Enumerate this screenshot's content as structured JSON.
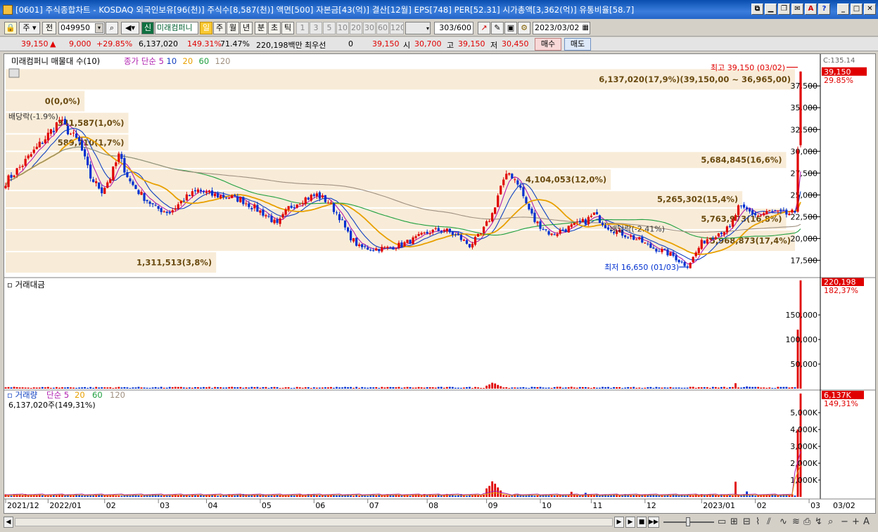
{
  "titlebar": {
    "text": "[0601] 주식종합차트 - KOSDAQ 외국인보유[96(천)] 주식수[8,587(천)] 액면[500] 자본금[43(억)] 결산[12월] EPS[748] PER[52.31] 시가총액[3,362(억)] 유통비율[58.7]",
    "buttons": [
      "⧉",
      "▁",
      "❐",
      "✉",
      "A",
      "?",
      "_",
      "□",
      "✕"
    ]
  },
  "toolbar": {
    "market": "주",
    "prev_label": "전",
    "code": "049950",
    "stock_name": "미래컴퍼니",
    "period_selected": "일",
    "periods": [
      "주",
      "월",
      "년",
      "분",
      "초",
      "틱"
    ],
    "intervals": [
      "1",
      "3",
      "5",
      "10",
      "20",
      "30",
      "60",
      "120"
    ],
    "count": "303/600",
    "date": "2023/03/02"
  },
  "infobar": {
    "price": "39,150",
    "change": "9,000",
    "change_pct": "+29.85%",
    "volume": "6,137,020",
    "volume_ratio": "149.31%",
    "turnover": "71.47%",
    "amount": "220,198백만",
    "pref_label": "최우선",
    "pref_value": "0",
    "ask": "39,150",
    "open_label": "시",
    "open": "30,700",
    "high_label": "고",
    "high": "39,150",
    "low_label": "저",
    "low": "30,450",
    "buy_label": "매수",
    "sell_label": "매도"
  },
  "colors": {
    "up": "#e00000",
    "down": "#0030d0",
    "ma5": "#b020b0",
    "ma10": "#1040c0",
    "ma20": "#e8a000",
    "ma60": "#20a040",
    "ma120": "#a09080",
    "band": "#f8ecd8"
  },
  "chart_data": [
    {
      "type": "candlestick",
      "legend_title": "미래컴퍼니 매물대 수(10)",
      "legend": [
        {
          "name": "종가 단순 5",
          "color": "#b020b0"
        },
        {
          "name": "10",
          "color": "#1040c0"
        },
        {
          "name": "20",
          "color": "#e8a000"
        },
        {
          "name": "60",
          "color": "#20a040"
        },
        {
          "name": "120",
          "color": "#a09080"
        }
      ],
      "y_ticks": [
        "37,500",
        "35,000",
        "32,500",
        "30,000",
        "27,500",
        "25,000",
        "22,500",
        "20,000",
        "17,500"
      ],
      "ylim": [
        16000,
        40500
      ],
      "top_badge": "C:135.14",
      "last_price_label": "39,150",
      "last_pct_label": "29.85%",
      "high_annotation": "최고 39,150 (03/02)",
      "low_annotation": "최저 16,650 (01/03)",
      "dividend_annotations": [
        "배당락(-1.9%)",
        "배당락(-2.41%)"
      ],
      "volume_profile": [
        {
          "low": 16000,
          "high": 18500,
          "label": "1,311,513(3,8%)"
        },
        {
          "low": 18500,
          "high": 21000,
          "label": "5,968,873(17,4%)"
        },
        {
          "low": 21000,
          "high": 23500,
          "label": "5,763,973(16,8%)"
        },
        {
          "low": 23500,
          "high": 25500,
          "label": "5,265,302(15,4%)"
        },
        {
          "low": 25500,
          "high": 28000,
          "label": "4,104,053(12,0%)"
        },
        {
          "low": 28000,
          "high": 30000,
          "label": "5,684,845(16,6%)"
        },
        {
          "low": 30000,
          "high": 32000,
          "label": "589,710(1,7%)"
        },
        {
          "low": 32000,
          "high": 34500,
          "label": "341,587(1,0%)"
        },
        {
          "low": 34500,
          "high": 37000,
          "label": "0(0,0%)"
        },
        {
          "low": 37000,
          "high": 39500,
          "label": "6,137,020(17,9%)(39,150,00 ~ 36,965,00)"
        }
      ],
      "price_anchors": [
        [
          0,
          26500
        ],
        [
          6,
          28500
        ],
        [
          14,
          31500
        ],
        [
          19,
          33500
        ],
        [
          23,
          32000
        ],
        [
          26,
          31000
        ],
        [
          30,
          27000
        ],
        [
          34,
          25500
        ],
        [
          37,
          27000
        ],
        [
          40,
          29500
        ],
        [
          44,
          26500
        ],
        [
          48,
          25000
        ],
        [
          53,
          23500
        ],
        [
          58,
          23000
        ],
        [
          63,
          24500
        ],
        [
          68,
          25500
        ],
        [
          73,
          25000
        ],
        [
          78,
          24800
        ],
        [
          83,
          24500
        ],
        [
          88,
          23500
        ],
        [
          93,
          22500
        ],
        [
          96,
          21500
        ],
        [
          100,
          23500
        ],
        [
          105,
          24500
        ],
        [
          110,
          25000
        ],
        [
          114,
          24200
        ],
        [
          118,
          22500
        ],
        [
          121,
          20500
        ],
        [
          125,
          19000
        ],
        [
          130,
          18800
        ],
        [
          135,
          18900
        ],
        [
          140,
          19300
        ],
        [
          145,
          20000
        ],
        [
          150,
          20800
        ],
        [
          155,
          21000
        ],
        [
          160,
          20200
        ],
        [
          164,
          19200
        ],
        [
          168,
          20500
        ],
        [
          172,
          22800
        ],
        [
          175,
          26000
        ],
        [
          178,
          27500
        ],
        [
          181,
          26500
        ],
        [
          184,
          24000
        ],
        [
          187,
          22000
        ],
        [
          190,
          21200
        ],
        [
          193,
          20400
        ],
        [
          197,
          21000
        ],
        [
          201,
          21500
        ],
        [
          205,
          22000
        ],
        [
          208,
          22800
        ],
        [
          212,
          21500
        ],
        [
          216,
          20800
        ],
        [
          220,
          20300
        ],
        [
          224,
          19800
        ],
        [
          228,
          19000
        ],
        [
          232,
          18600
        ],
        [
          236,
          18000
        ],
        [
          239,
          17200
        ],
        [
          241,
          16900
        ],
        [
          243,
          17800
        ],
        [
          246,
          19500
        ],
        [
          249,
          20200
        ],
        [
          253,
          20800
        ],
        [
          256,
          21200
        ],
        [
          259,
          23500
        ],
        [
          262,
          23200
        ],
        [
          266,
          22600
        ],
        [
          270,
          23100
        ],
        [
          273,
          22900
        ],
        [
          276,
          22800
        ],
        [
          279,
          23000
        ],
        [
          280,
          30150
        ],
        [
          281,
          30450
        ]
      ],
      "last_candle": {
        "open": 30700,
        "high": 39150,
        "low": 30450,
        "close": 39150
      }
    },
    {
      "type": "bar",
      "title": "거래대금",
      "y_ticks": [
        "150,000",
        "100,000",
        "50,000"
      ],
      "ylim": [
        0,
        220198
      ],
      "last_label": "220,198",
      "last_pct": "182,37%",
      "spikes": [
        {
          "day": 170,
          "value": 6000
        },
        {
          "day": 171,
          "value": 8500
        },
        {
          "day": 172,
          "value": 12000
        },
        {
          "day": 173,
          "value": 10500
        },
        {
          "day": 174,
          "value": 7500
        },
        {
          "day": 175,
          "value": 5000
        },
        {
          "day": 200,
          "value": 3800
        },
        {
          "day": 205,
          "value": 3000
        },
        {
          "day": 258,
          "value": 11000
        },
        {
          "day": 262,
          "value": 4500
        },
        {
          "day": 280,
          "value": 120000
        },
        {
          "day": 281,
          "value": 220198
        }
      ]
    },
    {
      "type": "bar",
      "title": "거래량",
      "legend": [
        {
          "name": "단순 5",
          "color": "#b020b0"
        },
        {
          "name": "20",
          "color": "#e8a000"
        },
        {
          "name": "60",
          "color": "#20a040"
        },
        {
          "name": "120",
          "color": "#a09080"
        }
      ],
      "value_label": "6,137,020주(149,31%)",
      "y_ticks": [
        "5,000K",
        "4,000K",
        "3,000K",
        "2,000K",
        "1,000K"
      ],
      "ylim": [
        0,
        6137
      ],
      "last_label": "6,137K",
      "last_pct": "149,31%",
      "spikes": [
        {
          "day": 170,
          "value": 500
        },
        {
          "day": 171,
          "value": 650
        },
        {
          "day": 172,
          "value": 920
        },
        {
          "day": 173,
          "value": 780
        },
        {
          "day": 174,
          "value": 560
        },
        {
          "day": 175,
          "value": 380
        },
        {
          "day": 200,
          "value": 300
        },
        {
          "day": 205,
          "value": 240
        },
        {
          "day": 258,
          "value": 900
        },
        {
          "day": 262,
          "value": 320
        },
        {
          "day": 280,
          "value": 4000
        },
        {
          "day": 281,
          "value": 6137
        }
      ]
    }
  ],
  "x_axis": {
    "labels": [
      {
        "day": 0,
        "text": "2021/12"
      },
      {
        "day": 15,
        "text": "2022/01"
      },
      {
        "day": 35,
        "text": "02"
      },
      {
        "day": 54,
        "text": "03"
      },
      {
        "day": 71,
        "text": "04"
      },
      {
        "day": 90,
        "text": "05"
      },
      {
        "day": 109,
        "text": "06"
      },
      {
        "day": 128,
        "text": "07"
      },
      {
        "day": 149,
        "text": "08"
      },
      {
        "day": 170,
        "text": "09"
      },
      {
        "day": 189,
        "text": "10"
      },
      {
        "day": 207,
        "text": "11"
      },
      {
        "day": 226,
        "text": "12"
      },
      {
        "day": 246,
        "text": "2023/01"
      },
      {
        "day": 265,
        "text": "02"
      },
      {
        "day": 284,
        "text": "03"
      }
    ],
    "right_label": "03/02"
  }
}
